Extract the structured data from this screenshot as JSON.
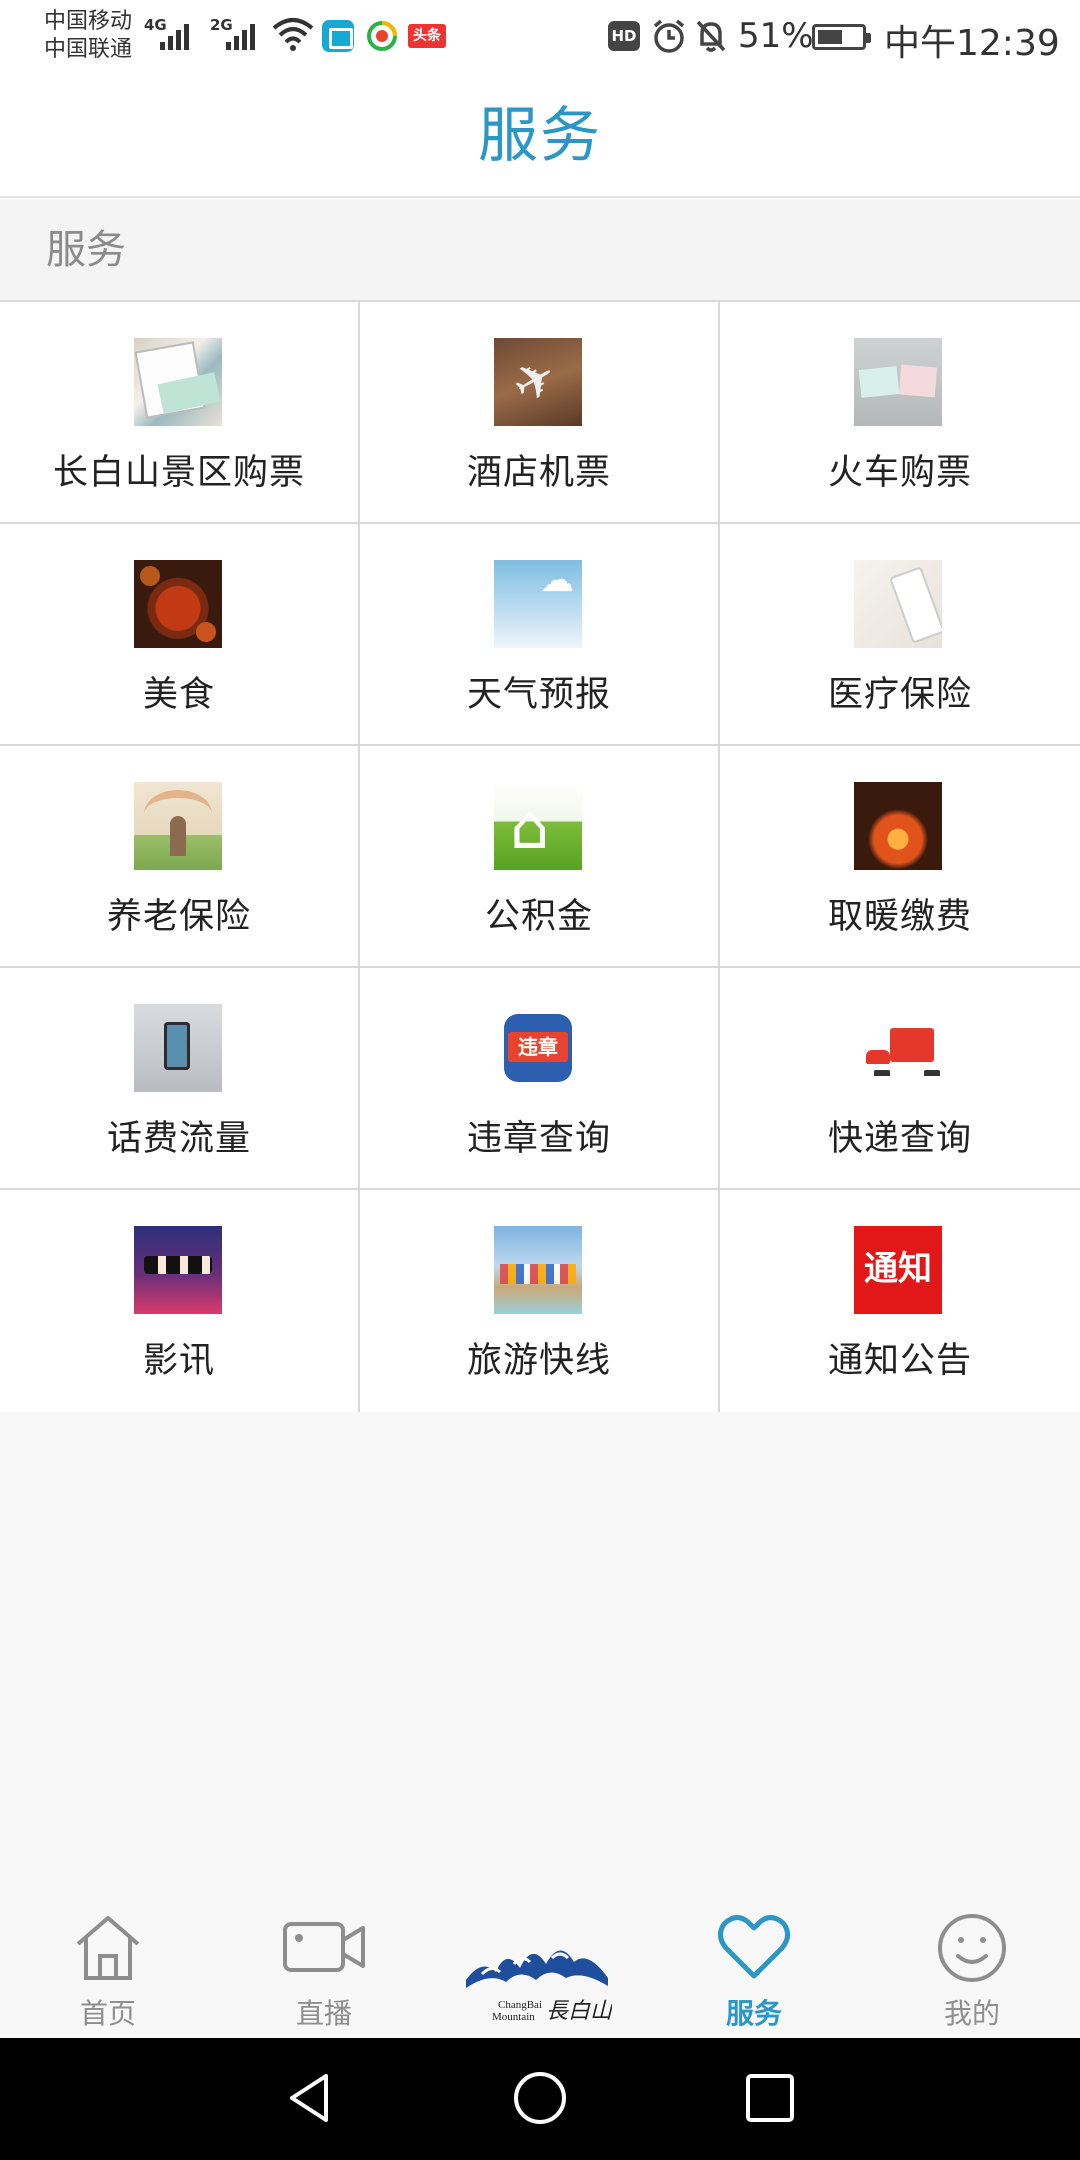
{
  "status_bar": {
    "carrier_1": "中国移动",
    "carrier_2": "中国联通",
    "net_1": "4G",
    "net_2": "2G",
    "news_badge": "头条",
    "hd": "HD",
    "battery": "51%",
    "time": "中午12:39"
  },
  "header": {
    "title": "服务"
  },
  "section": {
    "title": "服务"
  },
  "services": [
    {
      "label": "长白山景区购票",
      "icon": "ticket-image"
    },
    {
      "label": "酒店机票",
      "icon": "airplane-image"
    },
    {
      "label": "火车购票",
      "icon": "train-ticket-image"
    },
    {
      "label": "美食",
      "icon": "food-image"
    },
    {
      "label": "天气预报",
      "icon": "weather-image"
    },
    {
      "label": "医疗保险",
      "icon": "medical-image"
    },
    {
      "label": "养老保险",
      "icon": "pension-image"
    },
    {
      "label": "公积金",
      "icon": "house-fund-image"
    },
    {
      "label": "取暖缴费",
      "icon": "fire-image"
    },
    {
      "label": "话费流量",
      "icon": "phone-image"
    },
    {
      "label": "违章查询",
      "icon": "violation-icon",
      "icon_text": "违章"
    },
    {
      "label": "快递查询",
      "icon": "delivery-icon"
    },
    {
      "label": "影讯",
      "icon": "cinema-image"
    },
    {
      "label": "旅游快线",
      "icon": "tour-image"
    },
    {
      "label": "通知公告",
      "icon": "notice-icon",
      "icon_text": "通知"
    }
  ],
  "bottom_nav": {
    "items": [
      {
        "label": "首页",
        "icon": "home-icon"
      },
      {
        "label": "直播",
        "icon": "video-icon"
      },
      {
        "label": "服务",
        "icon": "heart-icon",
        "active": true
      },
      {
        "label": "我的",
        "icon": "smiley-icon"
      }
    ],
    "logo_text": "ChangBai Mountain 長白山"
  },
  "colors": {
    "accent": "#2b97c7",
    "inactive": "#8e8e8e",
    "background": "#f8f8f9"
  }
}
